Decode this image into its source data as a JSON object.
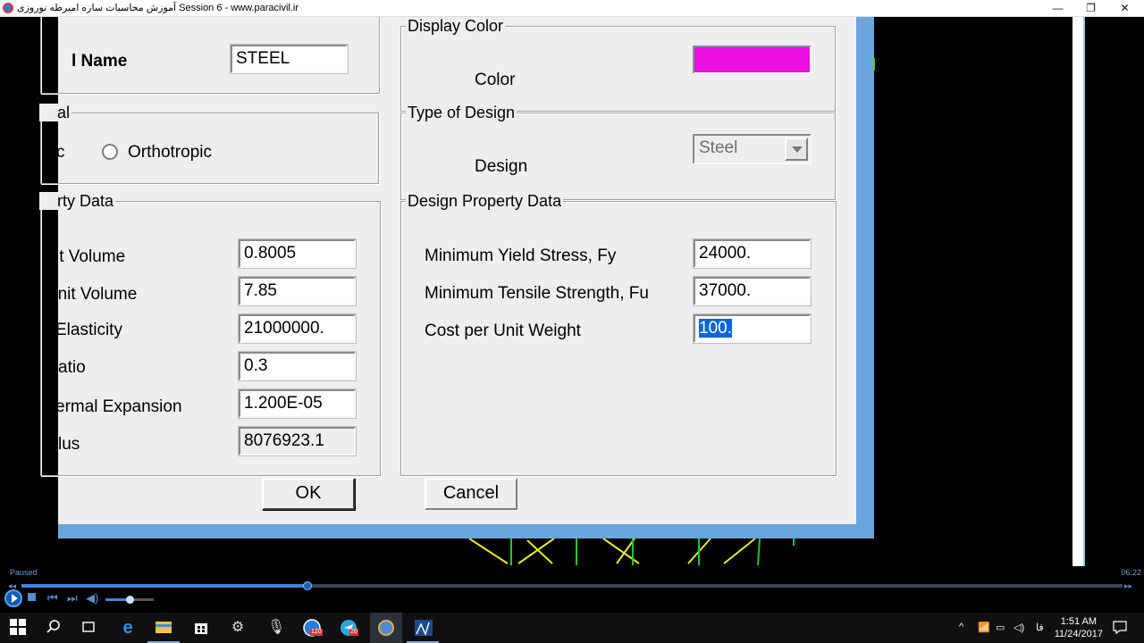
{
  "window": {
    "title": "آموزش محاسبات سازه امیرطه نوروزی Session 6 - www.paracivil.ir",
    "minimize": "—",
    "maximize": "❐",
    "close": "✕"
  },
  "dialog": {
    "name_group": {
      "label": "l Name",
      "value": "STEEL"
    },
    "analysis_group": {
      "title": "al",
      "isotropic_label": "c",
      "orthotropic_label": "Orthotropic"
    },
    "property_group": {
      "title": "rty Data",
      "rows": [
        {
          "label": "it Volume",
          "value": "0.8005"
        },
        {
          "label": "unit Volume",
          "value": "7.85"
        },
        {
          "label": "Elasticity",
          "value": "21000000."
        },
        {
          "label": "atio",
          "value": "0.3"
        },
        {
          "label": "ermal Expansion",
          "value": "1.200E-05"
        },
        {
          "label": "lus",
          "value": "8076923.1"
        }
      ]
    },
    "display_color": {
      "title": "Display Color",
      "label": "Color",
      "color": "#ea0fe0"
    },
    "type_of_design": {
      "title": "Type of Design",
      "label": "Design",
      "value": "Steel"
    },
    "design_property": {
      "title": "Design Property Data",
      "rows": [
        {
          "label": "Minimum Yield Stress, Fy",
          "value": "24000."
        },
        {
          "label": "Minimum Tensile Strength, Fu",
          "value": "37000."
        },
        {
          "label": "Cost per Unit Weight",
          "value": "100."
        }
      ]
    },
    "ok_label": "OK",
    "cancel_label": "Cancel"
  },
  "player": {
    "status": "Paused",
    "time": "06:22",
    "progress": 0.26,
    "volume": 0.5
  },
  "taskbar": {
    "lang": "فا",
    "time": "1:51 AM",
    "date": "11/24/2017",
    "badges": [
      "120",
      "26"
    ]
  }
}
